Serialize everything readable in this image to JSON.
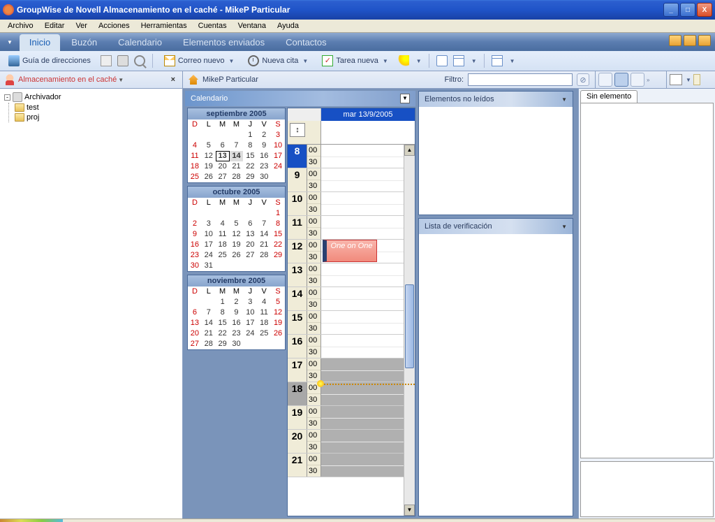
{
  "window": {
    "title": "GroupWise de Novell Almacenamiento en el caché - MikeP Particular"
  },
  "menu": [
    "Archivo",
    "Editar",
    "Ver",
    "Acciones",
    "Herramientas",
    "Cuentas",
    "Ventana",
    "Ayuda"
  ],
  "navtabs": {
    "items": [
      "Inicio",
      "Buzón",
      "Calendario",
      "Elementos enviados",
      "Contactos"
    ],
    "active": 0
  },
  "toolbar": {
    "addressbook": "Guía de direcciones",
    "newmail": "Correo nuevo",
    "newappt": "Nueva cita",
    "newtask": "Tarea nueva"
  },
  "mode": {
    "label": "Almacenamiento en el caché"
  },
  "account": {
    "name": "MikeP Particular"
  },
  "filter": {
    "label": "Filtro:",
    "value": ""
  },
  "tree": {
    "root": "Archivador",
    "children": [
      "test",
      "proj"
    ]
  },
  "calendar": {
    "title": "Calendario",
    "date_label": "mar 13/9/2005",
    "months": [
      {
        "name": "septiembre 2005",
        "dow": [
          "D",
          "L",
          "M",
          "M",
          "J",
          "V",
          "S"
        ],
        "lead": 4,
        "days": 30,
        "today": 13,
        "sel": 14,
        "sundays": [
          4,
          11,
          18,
          25
        ],
        "sats": [
          3,
          10,
          17,
          24
        ]
      },
      {
        "name": "octubre 2005",
        "dow": [
          "D",
          "L",
          "M",
          "M",
          "J",
          "V",
          "S"
        ],
        "lead": 6,
        "days": 31,
        "sundays": [
          2,
          9,
          16,
          23,
          30
        ],
        "sats": [
          1,
          8,
          15,
          22,
          29
        ]
      },
      {
        "name": "noviembre 2005",
        "dow": [
          "D",
          "L",
          "M",
          "M",
          "J",
          "V",
          "S"
        ],
        "lead": 2,
        "days": 30,
        "sundays": [
          6,
          13,
          20,
          27
        ],
        "sats": [
          5,
          12,
          19,
          26
        ]
      }
    ],
    "hours": [
      8,
      9,
      10,
      11,
      12,
      13,
      14,
      15,
      16,
      17,
      18,
      19,
      20,
      21
    ],
    "mins": [
      "00",
      "30"
    ],
    "current_hour": 8,
    "off_start": 17,
    "now_hour": 18,
    "appointment": {
      "title": "One on One",
      "start": 12.0,
      "end": 13.0
    }
  },
  "panels": {
    "unread": "Elementos no leídos",
    "checklist": "Lista de verificación"
  },
  "sidepanel": {
    "tab": "Sin elemento"
  }
}
